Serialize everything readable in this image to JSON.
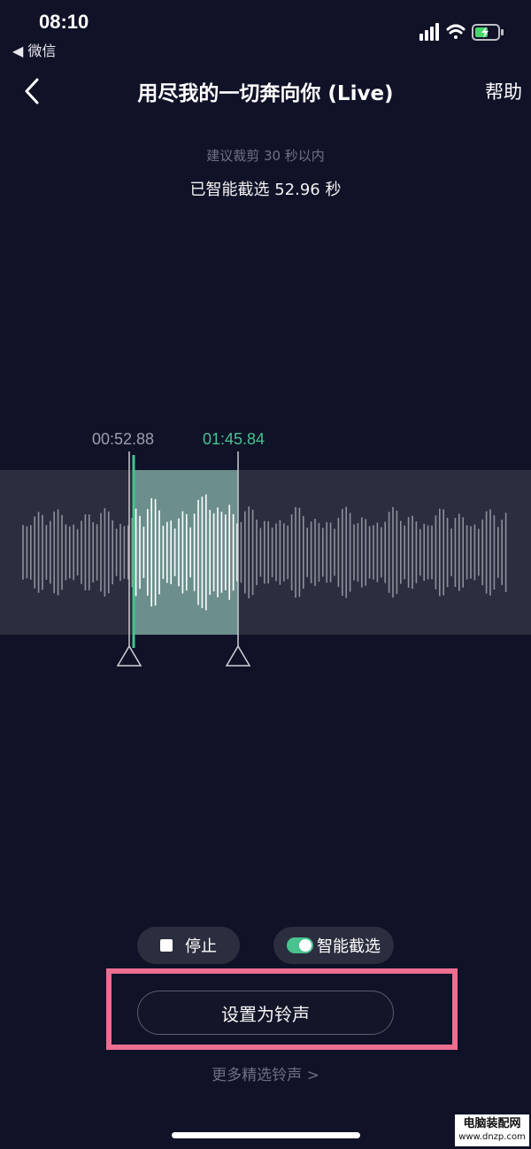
{
  "status_bar": {
    "time": "08:10",
    "back_label": "◀ 微信"
  },
  "nav": {
    "title": "用尽我的一切奔向你 (Live)",
    "help": "帮助"
  },
  "hint": "建议裁剪 30 秒以内",
  "selected_text": "已智能截选 52.96 秒",
  "clip": {
    "start_time": "00:52.88",
    "end_time": "01:45.84"
  },
  "controls": {
    "stop_label": "停止",
    "smart_label": "智能截选",
    "smart_enabled": true
  },
  "set_ringtone_label": "设置为铃声",
  "more_link": "更多精选铃声 >",
  "watermark": {
    "line1": "电脑装配网",
    "line2": "www.dnzp.com"
  },
  "colors": {
    "background": "#101228",
    "accent": "#48c28f",
    "highlight": "#ec6e90"
  }
}
